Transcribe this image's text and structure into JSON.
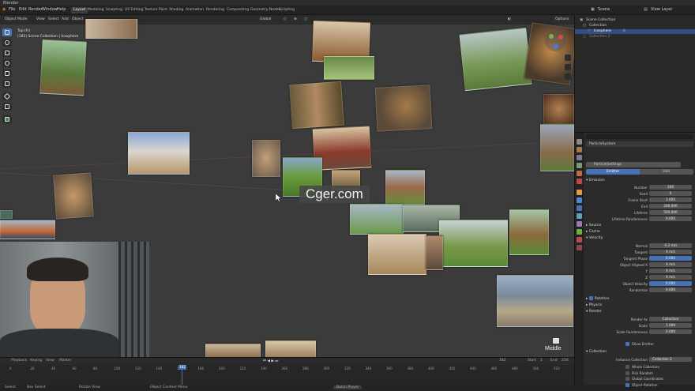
{
  "app": {
    "title": "Blender"
  },
  "menu": [
    "File",
    "Edit",
    "Render",
    "Window",
    "Help"
  ],
  "workspaces": [
    "Layout",
    "Modeling",
    "Sculpting",
    "UV Editing",
    "Texture Paint",
    "Shading",
    "Animation",
    "Rendering",
    "Compositing",
    "Geometry Nodes",
    "Scripting"
  ],
  "topright": {
    "scene": "Scene",
    "view_layer": "View Layer"
  },
  "viewport": {
    "mode": "Object Mode",
    "menus": [
      "View",
      "Select",
      "Add",
      "Object"
    ],
    "transform": "Global",
    "overlay_line1": "Top (fr)",
    "overlay_line2": "(182) Scene Collection | Icosphere",
    "options": "Options",
    "pivot_label": "Middle"
  },
  "watermark": "Cger.com",
  "outliner": {
    "rows": [
      "Scene Collection",
      "Collection",
      "Icosphere",
      "Collection 2"
    ]
  },
  "properties": {
    "system_name": "ParticleSystem",
    "settings_name": "ParticleSettings",
    "type_tabs": [
      "Emitter",
      "Hair"
    ],
    "sections": {
      "emission": "Emission",
      "source": "Source",
      "cache": "Cache",
      "velocity": "Velocity",
      "rotation": "Rotation",
      "physics": "Physics",
      "render": "Render",
      "collection": "Collection"
    },
    "emission_rows": [
      {
        "label": "Number",
        "value": "200"
      },
      {
        "label": "Seed",
        "value": "0"
      },
      {
        "label": "Frame Start",
        "value": "1.000"
      },
      {
        "label": "End",
        "value": "200.000"
      },
      {
        "label": "Lifetime",
        "value": "500.000"
      },
      {
        "label": "Lifetime Randomness",
        "value": "0.000"
      }
    ],
    "velocity_rows": [
      {
        "label": "Normal",
        "value": "-0.2 m/s"
      },
      {
        "label": "Tangent",
        "value": "0 m/s"
      },
      {
        "label": "Tangent Phase",
        "value": "0.000"
      },
      {
        "label": "Object Aligned X",
        "value": "0 m/s"
      },
      {
        "label": "Y",
        "value": "0 m/s"
      },
      {
        "label": "Z",
        "value": "0 m/s"
      },
      {
        "label": "Object Velocity",
        "value": "0.000"
      },
      {
        "label": "Randomize",
        "value": "0.000"
      }
    ],
    "render_rows": [
      {
        "label": "Render As",
        "value": "Collection"
      },
      {
        "label": "Scale",
        "value": "1.000"
      },
      {
        "label": "Scale Randomness",
        "value": "0.000"
      }
    ],
    "show_emitter": "Show Emitter",
    "instance_collection_label": "Instance Collection",
    "instance_collection_value": "Collection 2",
    "collection_options": [
      "Whole Collection",
      "Pick Random",
      "Global Coordinates",
      "Object Rotation"
    ]
  },
  "timeline": {
    "menus": [
      "Playback",
      "Keying",
      "View",
      "Marker"
    ],
    "current_frame": "182",
    "start_label": "Start",
    "start": "1",
    "end_label": "End",
    "end": "250",
    "ticks": [
      "0",
      "20",
      "40",
      "60",
      "80",
      "100",
      "120",
      "140",
      "160",
      "180",
      "200",
      "220",
      "240",
      "260",
      "280",
      "300",
      "320",
      "340",
      "360",
      "380",
      "400",
      "420",
      "440",
      "460",
      "480",
      "500",
      "520"
    ]
  },
  "status": {
    "select": "Select",
    "box_select": "Box Select",
    "rotate_view": "Rotate View",
    "context_menu": "Object Context Menu",
    "badge": "Batch Player"
  },
  "colors": {
    "accent": "#4772b3",
    "viewport_bg": "#3b3b3b"
  }
}
